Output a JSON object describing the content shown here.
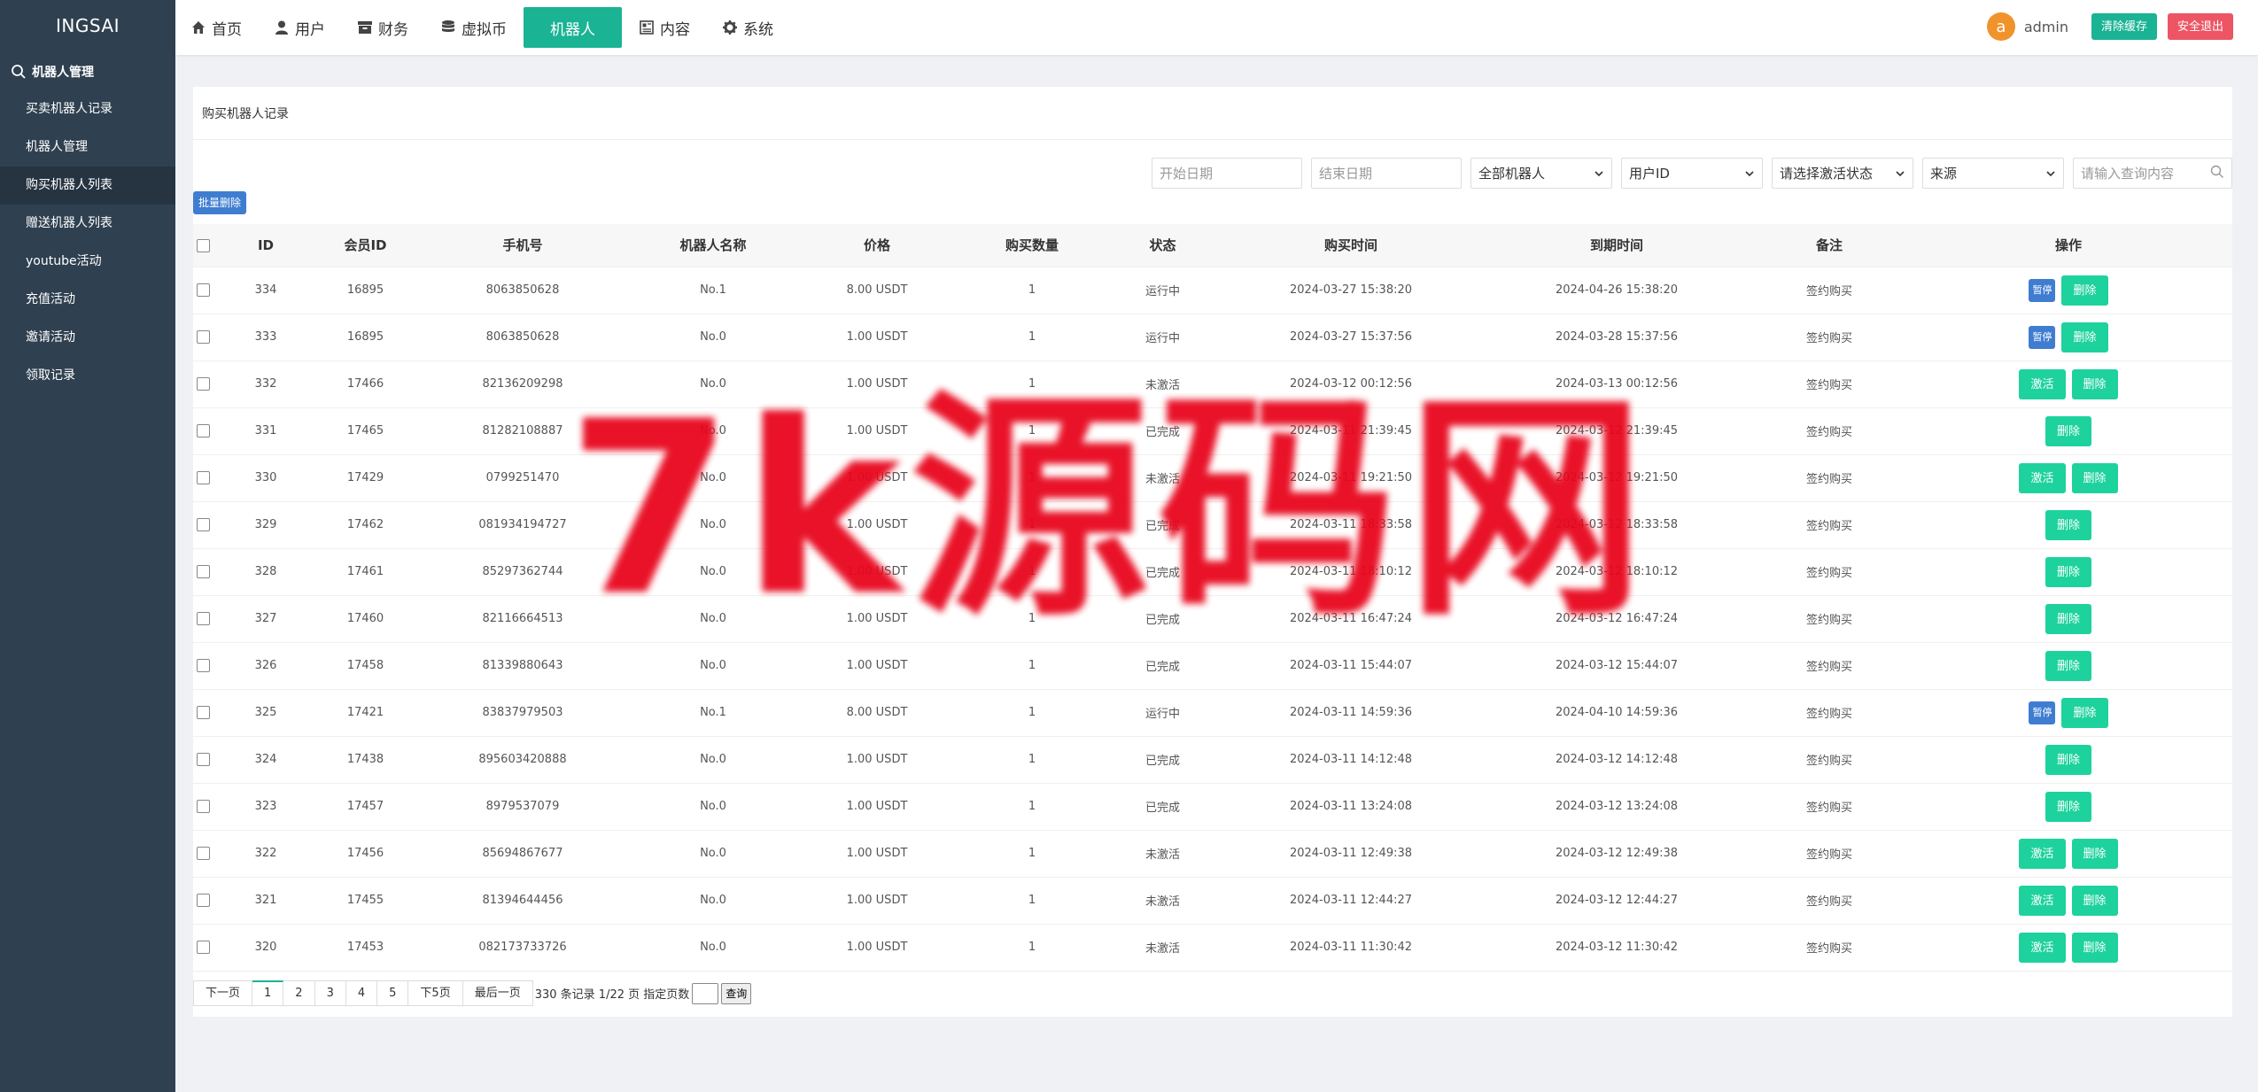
{
  "brand": "INGSAI",
  "sidebar": {
    "section": "机器人管理",
    "items": [
      {
        "label": "买卖机器人记录"
      },
      {
        "label": "机器人管理"
      },
      {
        "label": "购买机器人列表"
      },
      {
        "label": "赠送机器人列表"
      },
      {
        "label": "youtube活动"
      },
      {
        "label": "充值活动"
      },
      {
        "label": "邀请活动"
      },
      {
        "label": "领取记录"
      }
    ]
  },
  "topnav": {
    "items": [
      {
        "label": "首页"
      },
      {
        "label": "用户"
      },
      {
        "label": "财务"
      },
      {
        "label": "虚拟币"
      },
      {
        "label": "机器人"
      },
      {
        "label": "内容"
      },
      {
        "label": "系统"
      }
    ],
    "avatar_letter": "a",
    "admin": "admin",
    "clear_cache": "清除缓存",
    "logout": "安全退出"
  },
  "page": {
    "title": "购买机器人记录",
    "batch_delete": "批量删除"
  },
  "filters": {
    "start_date": "开始日期",
    "end_date": "结束日期",
    "robot": "全部机器人",
    "user": "用户ID",
    "status": "请选择激活状态",
    "source": "来源",
    "search": "请输入查询内容"
  },
  "table": {
    "headers": [
      "ID",
      "会员ID",
      "手机号",
      "机器人名称",
      "价格",
      "购买数量",
      "状态",
      "购买时间",
      "到期时间",
      "备注",
      "操作"
    ],
    "rows": [
      {
        "id": "334",
        "member": "16895",
        "phone": "8063850628",
        "robot": "No.1",
        "price": "8.00 USDT",
        "qty": "1",
        "status": "运行中",
        "buy": "2024-03-27 15:38:20",
        "expire": "2024-04-26 15:38:20",
        "note": "签约购买",
        "actions": [
          "暂停",
          "删除"
        ]
      },
      {
        "id": "333",
        "member": "16895",
        "phone": "8063850628",
        "robot": "No.0",
        "price": "1.00 USDT",
        "qty": "1",
        "status": "运行中",
        "buy": "2024-03-27 15:37:56",
        "expire": "2024-03-28 15:37:56",
        "note": "签约购买",
        "actions": [
          "暂停",
          "删除"
        ]
      },
      {
        "id": "332",
        "member": "17466",
        "phone": "82136209298",
        "robot": "No.0",
        "price": "1.00 USDT",
        "qty": "1",
        "status": "未激活",
        "buy": "2024-03-12 00:12:56",
        "expire": "2024-03-13 00:12:56",
        "note": "签约购买",
        "actions": [
          "激活",
          "删除"
        ]
      },
      {
        "id": "331",
        "member": "17465",
        "phone": "81282108887",
        "robot": "No.0",
        "price": "1.00 USDT",
        "qty": "1",
        "status": "已完成",
        "buy": "2024-03-11 21:39:45",
        "expire": "2024-03-12 21:39:45",
        "note": "签约购买",
        "actions": [
          "删除"
        ]
      },
      {
        "id": "330",
        "member": "17429",
        "phone": "0799251470",
        "robot": "No.0",
        "price": "1.00 USDT",
        "qty": "1",
        "status": "未激活",
        "buy": "2024-03-11 19:21:50",
        "expire": "2024-03-12 19:21:50",
        "note": "签约购买",
        "actions": [
          "激活",
          "删除"
        ]
      },
      {
        "id": "329",
        "member": "17462",
        "phone": "081934194727",
        "robot": "No.0",
        "price": "1.00 USDT",
        "qty": "1",
        "status": "已完成",
        "buy": "2024-03-11 18:33:58",
        "expire": "2024-03-12 18:33:58",
        "note": "签约购买",
        "actions": [
          "删除"
        ]
      },
      {
        "id": "328",
        "member": "17461",
        "phone": "85297362744",
        "robot": "No.0",
        "price": "1.00 USDT",
        "qty": "1",
        "status": "已完成",
        "buy": "2024-03-11 18:10:12",
        "expire": "2024-03-12 18:10:12",
        "note": "签约购买",
        "actions": [
          "删除"
        ]
      },
      {
        "id": "327",
        "member": "17460",
        "phone": "82116664513",
        "robot": "No.0",
        "price": "1.00 USDT",
        "qty": "1",
        "status": "已完成",
        "buy": "2024-03-11 16:47:24",
        "expire": "2024-03-12 16:47:24",
        "note": "签约购买",
        "actions": [
          "删除"
        ]
      },
      {
        "id": "326",
        "member": "17458",
        "phone": "81339880643",
        "robot": "No.0",
        "price": "1.00 USDT",
        "qty": "1",
        "status": "已完成",
        "buy": "2024-03-11 15:44:07",
        "expire": "2024-03-12 15:44:07",
        "note": "签约购买",
        "actions": [
          "删除"
        ]
      },
      {
        "id": "325",
        "member": "17421",
        "phone": "83837979503",
        "robot": "No.1",
        "price": "8.00 USDT",
        "qty": "1",
        "status": "运行中",
        "buy": "2024-03-11 14:59:36",
        "expire": "2024-04-10 14:59:36",
        "note": "签约购买",
        "actions": [
          "暂停",
          "删除"
        ]
      },
      {
        "id": "324",
        "member": "17438",
        "phone": "895603420888",
        "robot": "No.0",
        "price": "1.00 USDT",
        "qty": "1",
        "status": "已完成",
        "buy": "2024-03-11 14:12:48",
        "expire": "2024-03-12 14:12:48",
        "note": "签约购买",
        "actions": [
          "删除"
        ]
      },
      {
        "id": "323",
        "member": "17457",
        "phone": "8979537079",
        "robot": "No.0",
        "price": "1.00 USDT",
        "qty": "1",
        "status": "已完成",
        "buy": "2024-03-11 13:24:08",
        "expire": "2024-03-12 13:24:08",
        "note": "签约购买",
        "actions": [
          "删除"
        ]
      },
      {
        "id": "322",
        "member": "17456",
        "phone": "85694867677",
        "robot": "No.0",
        "price": "1.00 USDT",
        "qty": "1",
        "status": "未激活",
        "buy": "2024-03-11 12:49:38",
        "expire": "2024-03-12 12:49:38",
        "note": "签约购买",
        "actions": [
          "激活",
          "删除"
        ]
      },
      {
        "id": "321",
        "member": "17455",
        "phone": "81394644456",
        "robot": "No.0",
        "price": "1.00 USDT",
        "qty": "1",
        "status": "未激活",
        "buy": "2024-03-11 12:44:27",
        "expire": "2024-03-12 12:44:27",
        "note": "签约购买",
        "actions": [
          "激活",
          "删除"
        ]
      },
      {
        "id": "320",
        "member": "17453",
        "phone": "082173733726",
        "robot": "No.0",
        "price": "1.00 USDT",
        "qty": "1",
        "status": "未激活",
        "buy": "2024-03-11 11:30:42",
        "expire": "2024-03-12 11:30:42",
        "note": "签约购买",
        "actions": [
          "激活",
          "删除"
        ]
      }
    ]
  },
  "pager": {
    "prev": "下一页",
    "pages": [
      "1",
      "2",
      "3",
      "4",
      "5"
    ],
    "next5": "下5页",
    "last": "最后一页",
    "info": "330 条记录 1/22 页 指定页数",
    "go": "查询"
  },
  "watermark": "7k源码网",
  "colors": {
    "sidebar": "#2f4050",
    "accent": "#1ab394",
    "danger": "#ed5565",
    "action": "#1ed29d",
    "pause": "#3f7dd1",
    "watermark": "#e8061d"
  }
}
